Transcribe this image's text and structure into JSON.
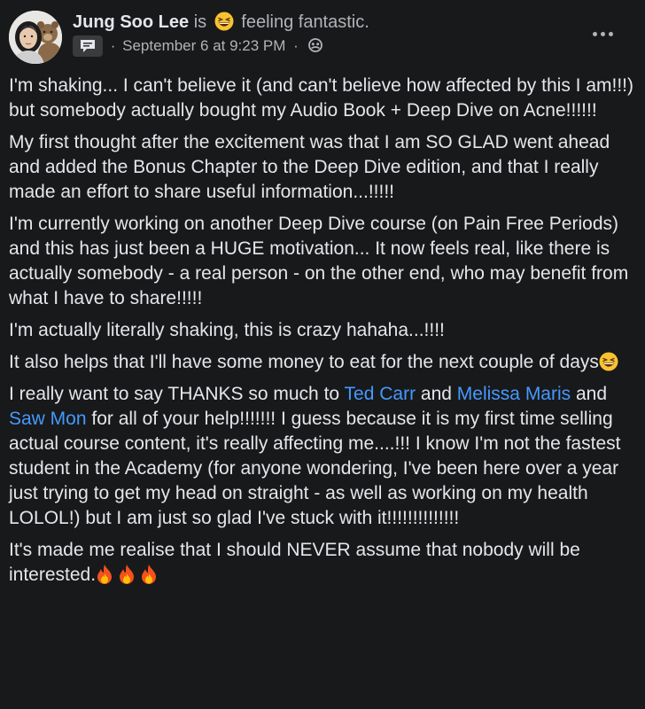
{
  "post": {
    "author": "Jung Soo Lee",
    "feeling_prefix": "is",
    "feeling": "feeling fantastic.",
    "separator": "·",
    "timestamp": "September 6 at 9:23 PM",
    "audience_icon": "group-audience-icon",
    "more_icon": "more-options-icon"
  },
  "paragraphs": {
    "p1": "I'm shaking... I can't believe it (and can't believe how affected by this I am!!!) but somebody actually bought my Audio Book + Deep Dive on Acne!!!!!!",
    "p2": "My first thought after the excitement was that I am SO GLAD went ahead and added the Bonus Chapter to the Deep Dive edition, and that I really made an effort to share useful information...!!!!!",
    "p3": "I'm currently working on another Deep Dive course (on Pain Free Periods) and this has just been a HUGE motivation... It now feels real, like there is actually somebody - a real person - on the other end, who may benefit from what I have to share!!!!!",
    "p4": "I'm actually literally shaking, this is crazy hahaha...!!!!",
    "p5": "It also helps that I'll have some money to eat for the next couple of days",
    "p6": {
      "before": "I really want to say THANKS so much to ",
      "mention1": "Ted Carr",
      "and1": " and ",
      "mention2": "Melissa Maris",
      "and2": " and ",
      "mention3": "Saw Mon",
      "after": " for all of your help!!!!!!! I guess because it is my first time selling actual course content, it's really affecting me....!!! I know I'm not the fastest student in the Academy (for anyone wondering, I've been here over a year just trying to get my head on straight - as well as working on my health LOLOL!) but I am just so glad I've stuck with it!!!!!!!!!!!!!!"
    },
    "p7": "It's made me realise that I should NEVER assume that nobody will be interested."
  },
  "colors": {
    "background": "#18191a",
    "text": "#e4e6eb",
    "secondary_text": "#b0b3b8",
    "mention": "#4599ff"
  }
}
